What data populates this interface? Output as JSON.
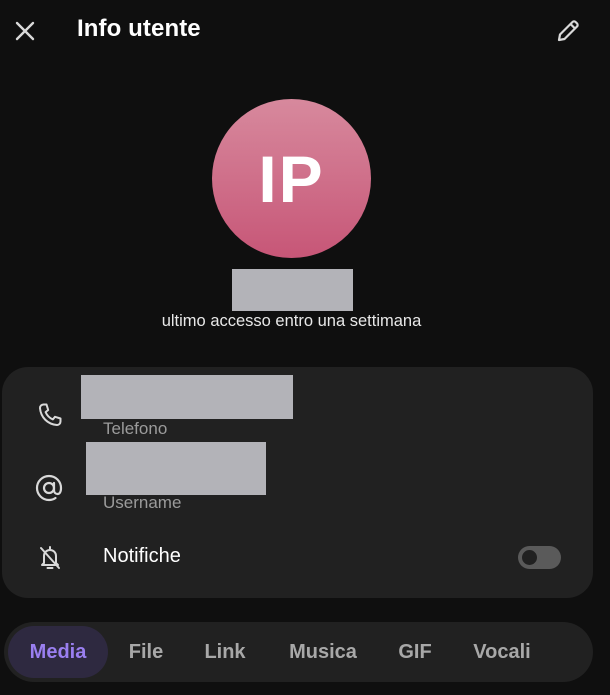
{
  "header": {
    "title": "Info utente",
    "close_icon": "close-icon",
    "edit_icon": "pencil-icon"
  },
  "profile": {
    "initials": "IP",
    "status": "ultimo accesso entro una settimana",
    "avatar_colors": [
      "#d7899d",
      "#c75677"
    ]
  },
  "info": {
    "phone_label": "Telefono",
    "username_label": "Username",
    "notifications_label": "Notifiche",
    "notifications_enabled": false
  },
  "tabs": [
    {
      "label": "Media",
      "active": true
    },
    {
      "label": "File",
      "active": false
    },
    {
      "label": "Link",
      "active": false
    },
    {
      "label": "Musica",
      "active": false
    },
    {
      "label": "GIF",
      "active": false
    },
    {
      "label": "Vocali",
      "active": false
    }
  ],
  "colors": {
    "background": "#0f0f0f",
    "card": "#212121",
    "accent": "#9a7ff0",
    "redaction": "#b3b3b8"
  }
}
